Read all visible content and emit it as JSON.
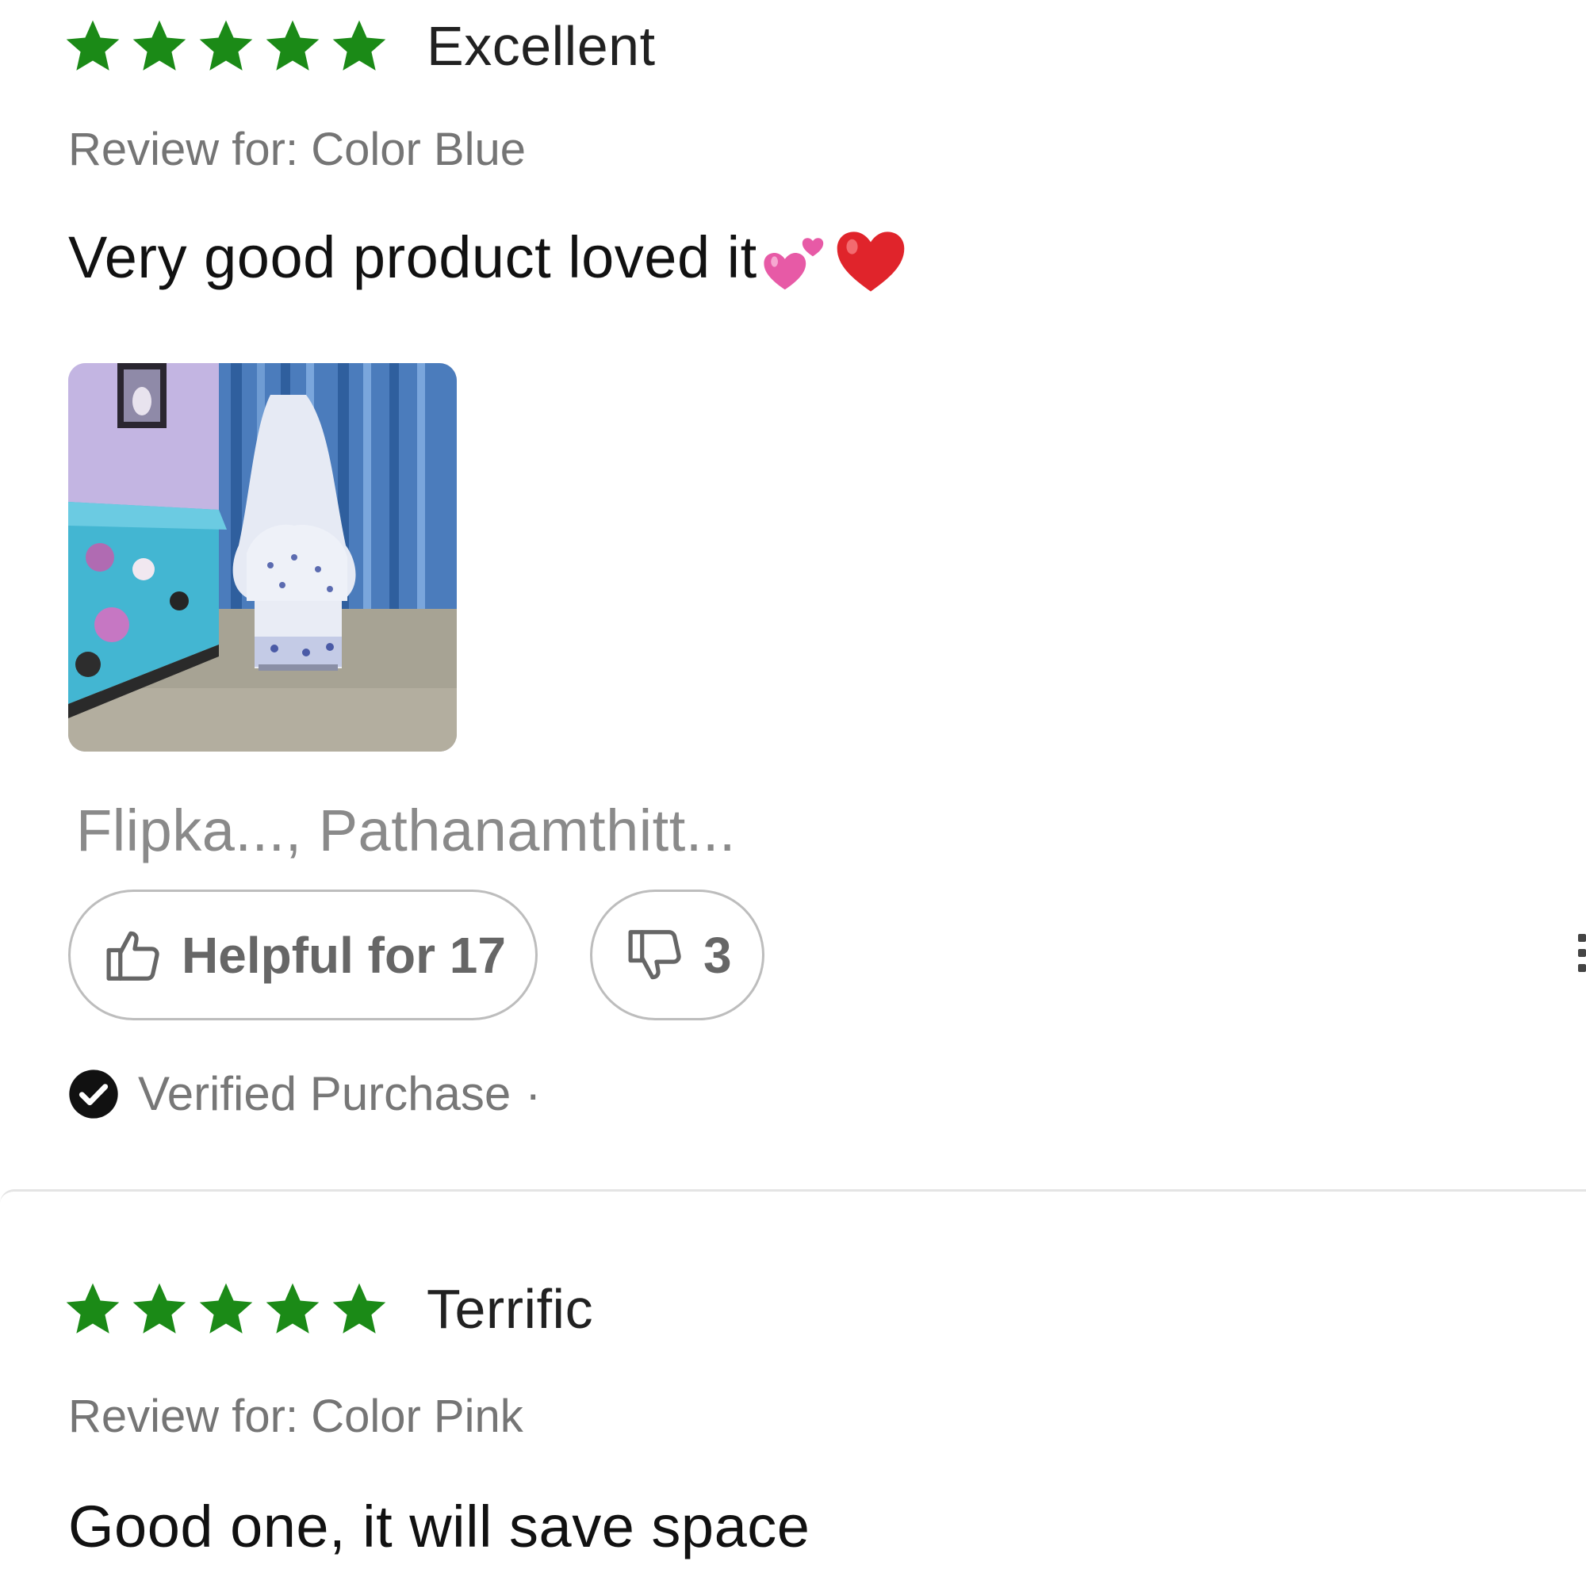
{
  "reviews": [
    {
      "rating": 5,
      "rating_label": "Excellent",
      "variant": "Review for: Color Blue",
      "text": "Very good product loved it",
      "emojis": [
        "two-hearts",
        "red-heart"
      ],
      "photo": "product photo: baby cradle with mosquito net in a bedroom",
      "reviewer": "Flipka..., Pathanamthitt...",
      "helpful_label": "Helpful for 17",
      "unhelpful_count": "3",
      "verified_label": "Verified Purchase",
      "separator": "·"
    },
    {
      "rating": 5,
      "rating_label": "Terrific",
      "variant": "Review for: Color Pink",
      "text": "Good one, it will save space"
    }
  ],
  "colors": {
    "star": "#1b8a17",
    "muted_text": "#757575",
    "pill_border": "#bdbdbd"
  },
  "icons": [
    "star-icon",
    "thumbs-up-icon",
    "thumbs-down-icon",
    "check-circle-icon",
    "more-vertical-icon"
  ]
}
